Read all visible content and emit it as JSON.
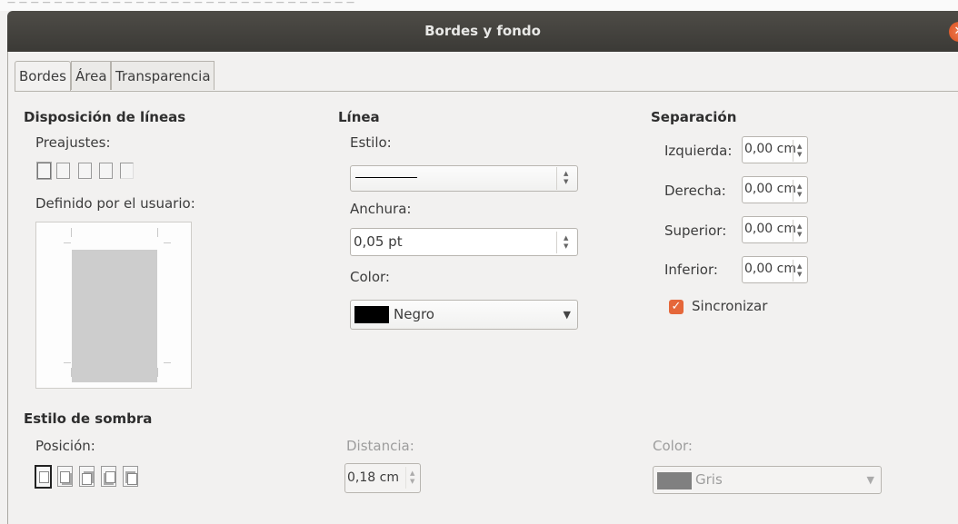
{
  "window": {
    "title": "Bordes y fondo",
    "close_icon": "close-icon"
  },
  "tabs": [
    {
      "label": "Bordes",
      "active": true
    },
    {
      "label": "Área",
      "active": false
    },
    {
      "label": "Transparencia",
      "active": false
    }
  ],
  "line_arrangement": {
    "header": "Disposición de líneas",
    "presets_label": "Preajustes:",
    "user_defined_label": "Definido por el usuario:"
  },
  "line": {
    "header": "Línea",
    "style_label": "Estilo:",
    "width_label": "Anchura:",
    "width_value": "0,05 pt",
    "color_label": "Color:",
    "color_value": "Negro",
    "color_swatch": "#000000"
  },
  "padding": {
    "header": "Separación",
    "left_label": "Izquierda:",
    "left_value": "0,00 cm",
    "right_label": "Derecha:",
    "right_value": "0,00 cm",
    "top_label": "Superior:",
    "top_value": "0,00 cm",
    "bottom_label": "Inferior:",
    "bottom_value": "0,00 cm",
    "sync_label": "Sincronizar",
    "sync_checked": true
  },
  "shadow": {
    "header": "Estilo de sombra",
    "position_label": "Posición:",
    "distance_label": "Distancia:",
    "distance_value": "0,18 cm",
    "color_label": "Color:",
    "color_value": "Gris",
    "color_swatch": "#808080"
  },
  "colors": {
    "accent": "#e5673a",
    "titlebar": "#3f3e3a"
  }
}
